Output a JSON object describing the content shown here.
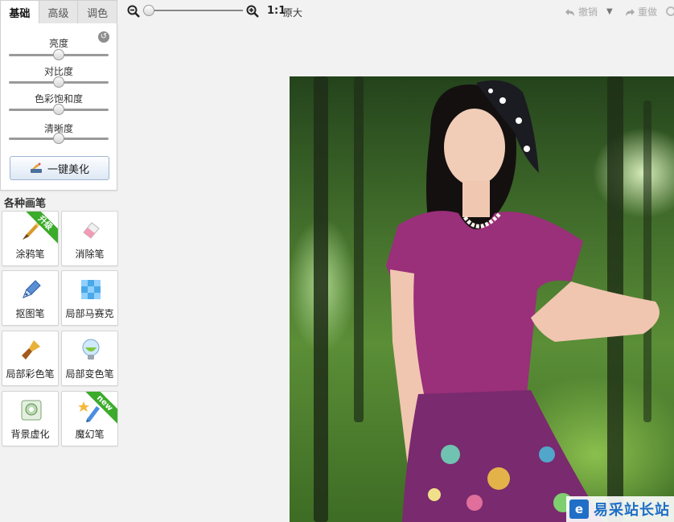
{
  "tabs": [
    {
      "label": "基础",
      "active": true
    },
    {
      "label": "高级",
      "active": false
    },
    {
      "label": "调色",
      "active": false
    }
  ],
  "adjustments": [
    {
      "label": "亮度",
      "value": 0.5
    },
    {
      "label": "对比度",
      "value": 0.5
    },
    {
      "label": "色彩饱和度",
      "value": 0.5
    },
    {
      "label": "清晰度",
      "value": 0.5
    }
  ],
  "one_click_label": "一键美化",
  "brushes_title": "各种画笔",
  "brushes": [
    {
      "label": "涂鸦笔",
      "badge": "升级",
      "icon": "crayon-icon"
    },
    {
      "label": "消除笔",
      "badge": "",
      "icon": "eraser-icon"
    },
    {
      "label": "抠图笔",
      "badge": "",
      "icon": "cutout-pen-icon"
    },
    {
      "label": "局部马赛克",
      "badge": "",
      "icon": "mosaic-icon"
    },
    {
      "label": "局部彩色笔",
      "badge": "",
      "icon": "color-brush-icon"
    },
    {
      "label": "局部变色笔",
      "badge": "",
      "icon": "color-change-icon"
    },
    {
      "label": "背景虚化",
      "badge": "",
      "icon": "blur-background-icon"
    },
    {
      "label": "魔幻笔",
      "badge": "new",
      "icon": "magic-pen-icon"
    }
  ],
  "toolbar": {
    "zoom_level": 0,
    "ratio_label": "1:1",
    "original_label": "原大",
    "undo_label": "撤销",
    "redo_label": "重做"
  },
  "watermark": {
    "logo_letter": "e",
    "text": "易采站长站"
  },
  "colors": {
    "badge_green": "#3cab2b",
    "accent_blue": "#1f6fc7"
  }
}
